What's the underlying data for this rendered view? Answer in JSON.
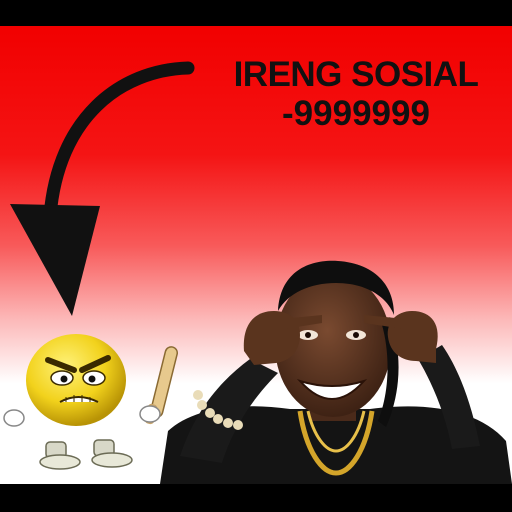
{
  "caption": {
    "line1": "IRENG SOSIAL",
    "line2": "-9999999"
  },
  "colors": {
    "banner_red": "#f20000",
    "text": "#111111",
    "emoji_yellow": "#f2d21c",
    "arrow": "#111111"
  },
  "icons": {
    "arrow": "curved-down-arrow",
    "emoji": "angry-smiley-with-bat",
    "person": "man-pointing-at-head"
  }
}
